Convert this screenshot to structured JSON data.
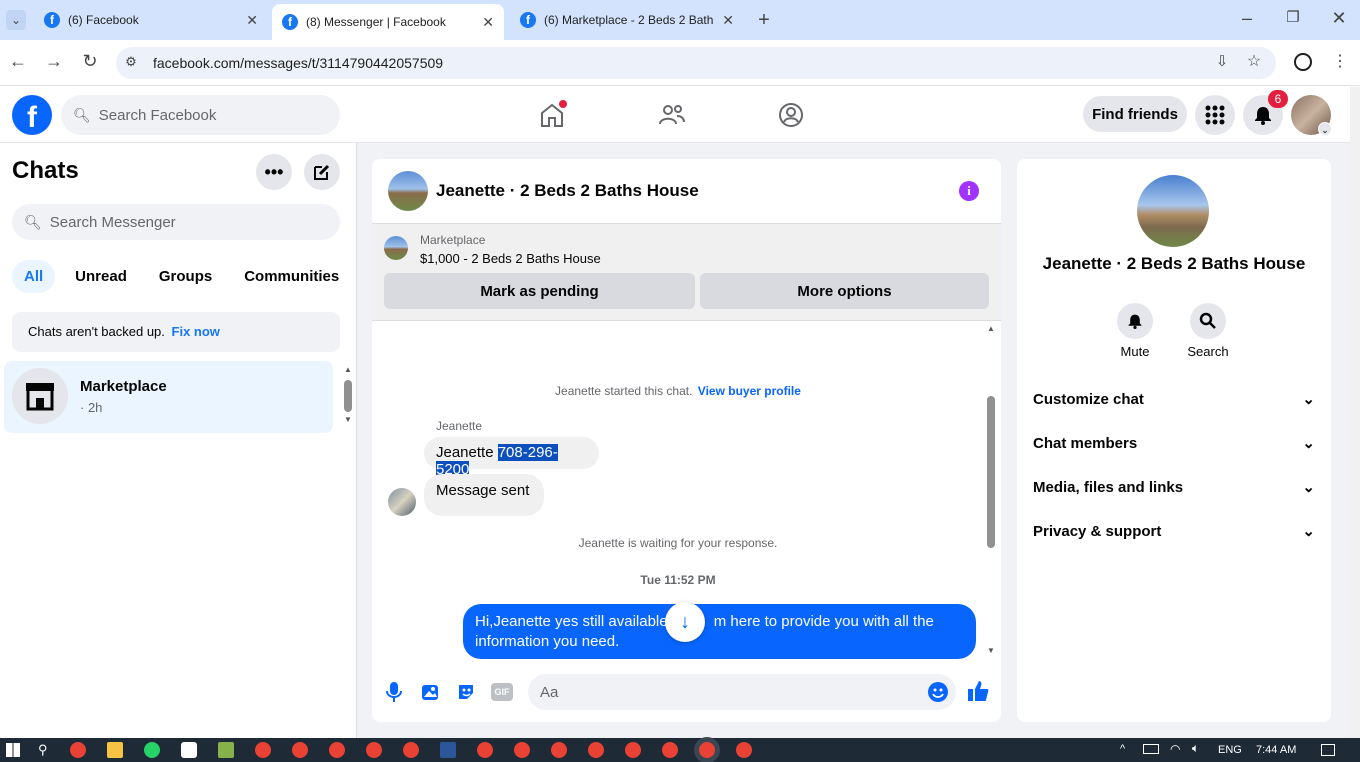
{
  "browser": {
    "tabs": [
      {
        "title": "(6) Facebook"
      },
      {
        "title": "(8) Messenger | Facebook"
      },
      {
        "title": "(6) Marketplace - 2 Beds 2 Bath"
      }
    ],
    "url": "facebook.com/messages/t/3114790442057509"
  },
  "fb_header": {
    "search_placeholder": "Search Facebook",
    "find_friends": "Find friends",
    "notif_count": "6"
  },
  "chats": {
    "title": "Chats",
    "search_placeholder": "Search Messenger",
    "filters": [
      "All",
      "Unread",
      "Groups",
      "Communities"
    ],
    "backup_text": "Chats aren't backed up.",
    "fix_now": "Fix now",
    "items": [
      {
        "name": "Marketplace",
        "meta": "· 2h"
      }
    ]
  },
  "conversation": {
    "title": "Jeanette · 2 Beds 2 Baths House",
    "listing_source": "Marketplace",
    "listing": "$1,000 - 2 Beds 2 Baths House",
    "mark_pending": "Mark as pending",
    "more_options": "More options",
    "started_text": "Jeanette started this chat.",
    "view_profile": "View buyer profile",
    "sender": "Jeanette",
    "msg1_name": "Jeanette",
    "msg1_phone": "708-296-5200",
    "msg2": "Message sent",
    "waiting": "Jeanette is waiting for your response.",
    "timestamp": "Tue 11:52 PM",
    "outgoing_a": "Hi,Jeanette yes still available,",
    "outgoing_b": "m here to provide you with all the",
    "outgoing_c": "information you need.",
    "composer_placeholder": "Aa"
  },
  "details": {
    "name": "Jeanette · 2 Beds 2 Baths House",
    "mute": "Mute",
    "search": "Search",
    "sections": [
      "Customize chat",
      "Chat members",
      "Media, files and links",
      "Privacy & support"
    ]
  },
  "taskbar": {
    "lang": "ENG",
    "time": "7:44 AM"
  },
  "colors": {
    "accent": "#1877f2",
    "outgoing": "#0866ff",
    "info": "#a033ff"
  }
}
